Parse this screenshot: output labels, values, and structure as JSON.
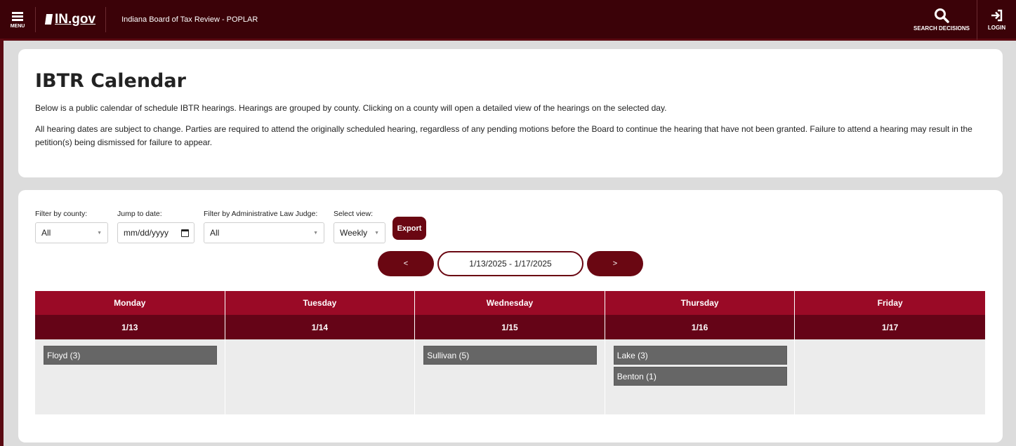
{
  "header": {
    "menu_label": "MENU",
    "logo_text": "IN.gov",
    "site_title": "Indiana Board of Tax Review - POPLAR",
    "search_label": "SEARCH DECISIONS",
    "login_label": "LOGIN",
    "colors": {
      "bar": "#3b0208"
    }
  },
  "intro": {
    "title": "IBTR Calendar",
    "paragraph1": "Below is a public calendar of schedule IBTR hearings. Hearings are grouped by county. Clicking on a county will open a detailed view of the hearings on the selected day.",
    "paragraph2": "All hearing dates are subject to change. Parties are required to attend the originally scheduled hearing, regardless of any pending motions before the Board to continue the hearing that have not been granted. Failure to attend a hearing may result in the petition(s) being dismissed for failure to appear."
  },
  "filters": {
    "county_label": "Filter by county:",
    "county_value": "All",
    "date_label": "Jump to date:",
    "date_placeholder": "mm/dd/yyyy",
    "judge_label": "Filter by Administrative Law Judge:",
    "judge_value": "All",
    "view_label": "Select view:",
    "view_value": "Weekly",
    "export_label": "Export"
  },
  "nav": {
    "prev_label": "<",
    "range_label": "1/13/2025 - 1/17/2025",
    "next_label": ">"
  },
  "calendar": {
    "days": [
      {
        "name": "Monday",
        "date": "1/13",
        "events": [
          "Floyd (3)"
        ]
      },
      {
        "name": "Tuesday",
        "date": "1/14",
        "events": []
      },
      {
        "name": "Wednesday",
        "date": "1/15",
        "events": [
          "Sullivan (5)"
        ]
      },
      {
        "name": "Thursday",
        "date": "1/16",
        "events": [
          "Lake (3)",
          "Benton (1)"
        ]
      },
      {
        "name": "Friday",
        "date": "1/17",
        "events": []
      }
    ],
    "colors": {
      "day_header": "#9a0a26",
      "date_header": "#650417",
      "event": "#666666",
      "accent": "#6a0712"
    }
  }
}
